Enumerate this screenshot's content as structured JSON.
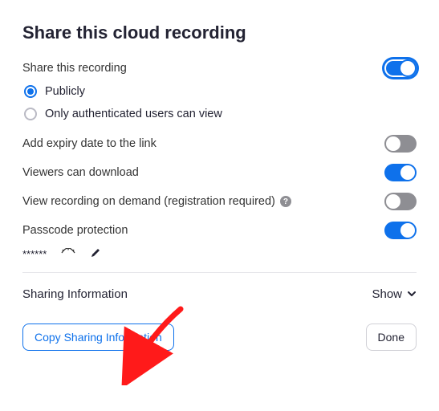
{
  "title": "Share this cloud recording",
  "shareRecording": {
    "label": "Share this recording",
    "on": true,
    "options": {
      "publicly": "Publicly",
      "authOnly": "Only authenticated users can view",
      "selected": "publicly"
    }
  },
  "expiry": {
    "label": "Add expiry date to the link",
    "on": false
  },
  "download": {
    "label": "Viewers can download",
    "on": true
  },
  "onDemand": {
    "label": "View recording on demand (registration required)",
    "on": false
  },
  "passcode": {
    "label": "Passcode protection",
    "on": true,
    "masked": "******"
  },
  "sharingInfo": {
    "label": "Sharing Information",
    "toggleLabel": "Show"
  },
  "buttons": {
    "copy": "Copy Sharing Information",
    "done": "Done"
  }
}
